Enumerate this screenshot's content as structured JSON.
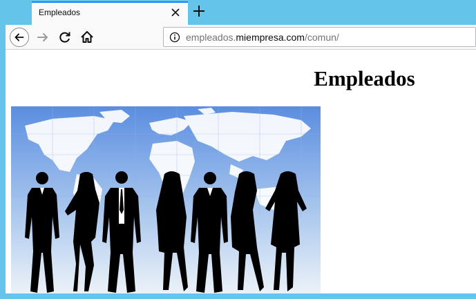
{
  "browser": {
    "tab_title": "Empleados",
    "url_host_prefix": "empleados.",
    "url_host": "miempresa.com",
    "url_path": "/comun/"
  },
  "page": {
    "heading": "Empleados",
    "image_alt": "silhouettes of business people in front of a world map"
  },
  "colors": {
    "frame": "#64c4ea",
    "tab_accent": "#0a84ff",
    "toolbar": "#f9f9fa"
  }
}
